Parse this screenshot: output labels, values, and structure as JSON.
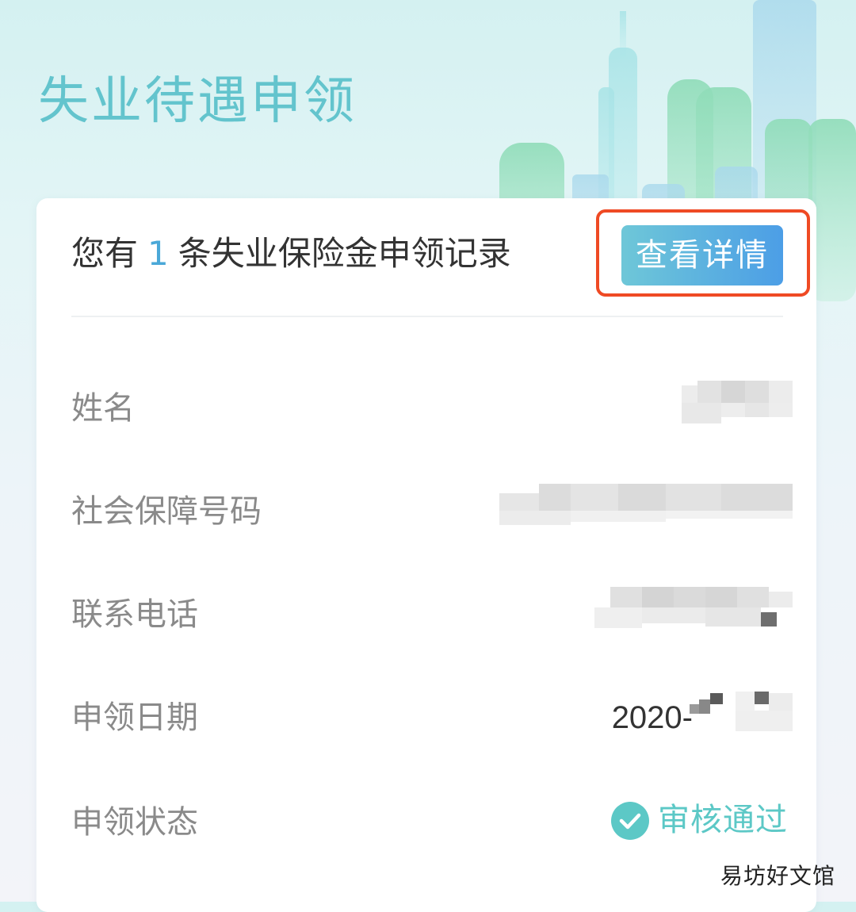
{
  "header": {
    "title": "失业待遇申领"
  },
  "summary": {
    "prefix": "您有",
    "count": "1",
    "suffix": "条失业保险金申领记录",
    "detail_button": "查看详情"
  },
  "fields": [
    {
      "label": "姓名",
      "value": ""
    },
    {
      "label": "社会保障号码",
      "value": ""
    },
    {
      "label": "联系电话",
      "value": ""
    },
    {
      "label": "申领日期",
      "value": "2020-"
    },
    {
      "label": "申领状态",
      "value": "审核通过"
    }
  ],
  "watermark": "易坊好文馆",
  "colors": {
    "title": "#63c4cd",
    "count": "#4aa8d8",
    "highlight": "#ef4a24",
    "status": "#5cc8c6"
  }
}
